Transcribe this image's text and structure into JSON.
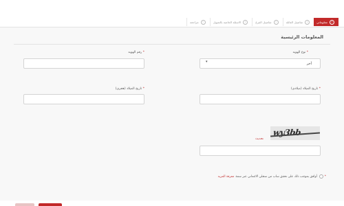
{
  "stepper": {
    "steps": [
      {
        "label": "معلوماتي",
        "icon": "!",
        "active": true
      },
      {
        "label": "تفاصيل العائلة",
        "icon": "!",
        "active": false
      },
      {
        "label": "تفاصيل الفرع",
        "icon": "!",
        "active": false
      },
      {
        "label": "الاسئلة الخاصة بالتمويل",
        "icon": "!",
        "active": false
      },
      {
        "label": "مراجعة",
        "icon": "!",
        "active": false
      }
    ]
  },
  "form": {
    "section_title": "المعلومات الرئيسية",
    "id_type": {
      "label": "نوع الهويه",
      "required_mark": "*",
      "value": "أخر",
      "caret": "▾"
    },
    "id_number": {
      "label": "رقم الهويه",
      "required_mark": "*",
      "value": ""
    },
    "birth_gregorian": {
      "label": "تاريخ الميلاد (ميلادي)",
      "required_mark": "*",
      "value": ""
    },
    "birth_hijri": {
      "label": "تاريخ الميلاد (هجري)",
      "required_mark": "*",
      "value": ""
    },
    "captcha": {
      "image_text": "wy3bb",
      "refresh_label": "تحديث",
      "input_value": ""
    },
    "agree": {
      "required_mark": "*",
      "text": "أوافق بموجب ذلك على تحقق ساب من سجلي الائتماني عبر سمة",
      "link": "معرفة المزيد"
    }
  },
  "buttons": {
    "secondary_label": "",
    "primary_label": ""
  }
}
